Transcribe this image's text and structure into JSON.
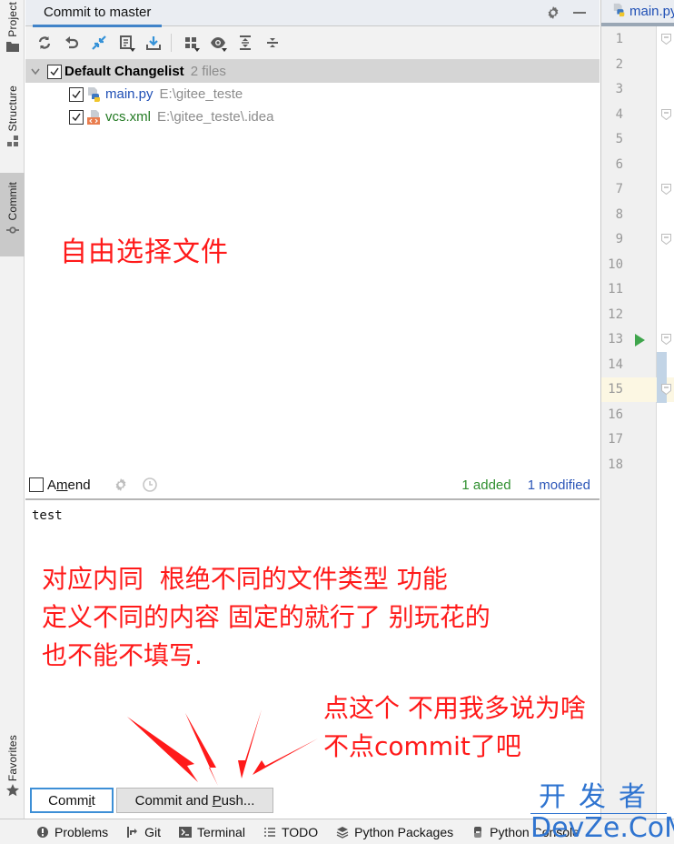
{
  "left_stripe": {
    "items": [
      {
        "label": "Project",
        "icon": "folder-icon"
      },
      {
        "label": "Structure",
        "icon": "structure-icon"
      },
      {
        "label": "Commit",
        "icon": "commit-icon",
        "active": true
      },
      {
        "label": "Favorites",
        "icon": "star-icon"
      }
    ]
  },
  "panel": {
    "tab_title": "Commit to master",
    "toolbar": [
      {
        "name": "refresh",
        "tooltip": "Refresh"
      },
      {
        "name": "rollback",
        "tooltip": "Rollback"
      },
      {
        "name": "show-diff",
        "tooltip": "Show Diff"
      },
      {
        "name": "changelist",
        "tooltip": "Changelist"
      },
      {
        "name": "shelve",
        "tooltip": "Shelve"
      },
      {
        "name": "group-by",
        "tooltip": "Group By"
      },
      {
        "name": "view-options",
        "tooltip": "View Options"
      },
      {
        "name": "expand-all",
        "tooltip": "Expand All"
      },
      {
        "name": "collapse-all",
        "tooltip": "Collapse All"
      }
    ],
    "changelist": {
      "name": "Default Changelist",
      "count": "2 files",
      "checked": true,
      "files": [
        {
          "name": "main.py",
          "path": "E:\\gitee_teste",
          "checked": true,
          "type": "python"
        },
        {
          "name": "vcs.xml",
          "path": "E:\\gitee_teste\\.idea",
          "checked": true,
          "type": "xml"
        }
      ]
    },
    "amend": {
      "label_before": "A",
      "label_mnemonic": "m",
      "label_after": "end",
      "checked": false
    },
    "stats": {
      "added": "1 added",
      "modified": "1 modified"
    },
    "commit_message": "test",
    "buttons": {
      "commit_before": "Comm",
      "commit_mnemonic": "i",
      "commit_after": "t",
      "push_before": "Commit and ",
      "push_mnemonic": "P",
      "push_after": "ush..."
    }
  },
  "annotations": {
    "select_files": "自由选择文件",
    "message_note": "对应内同  根绝不同的文件类型 功能\n定义不同的内容 固定的就行了 别玩花的\n也不能不填写.",
    "click_note": "点这个 不用我多说为啥\n不点commit了吧",
    "color": "#ff1a1a"
  },
  "editor": {
    "tab_label": "main.py",
    "line_numbers": [
      "1",
      "2",
      "3",
      "4",
      "5",
      "6",
      "7",
      "8",
      "9",
      "10",
      "11",
      "12",
      "13",
      "14",
      "15",
      "16",
      "17",
      "18"
    ],
    "current_line": "15",
    "run_line": "13"
  },
  "bottombar": {
    "items": [
      {
        "label": "Problems",
        "icon": "problems-icon"
      },
      {
        "label": "Git",
        "icon": "git-icon"
      },
      {
        "label": "Terminal",
        "icon": "terminal-icon"
      },
      {
        "label": "TODO",
        "icon": "todo-icon"
      },
      {
        "label": "Python Packages",
        "icon": "packages-icon"
      },
      {
        "label": "Python Console",
        "icon": "python-console-icon"
      }
    ]
  },
  "watermark": {
    "top": "开发者",
    "bottom": "DevZe.CoM"
  }
}
